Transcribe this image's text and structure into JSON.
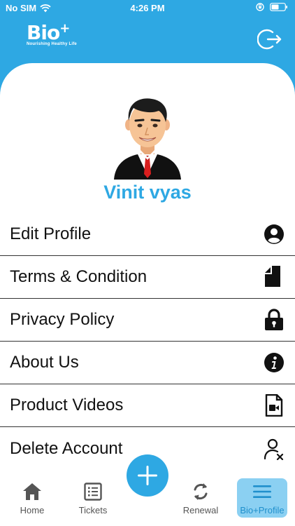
{
  "status_bar": {
    "carrier": "No SIM",
    "time": "4:26 PM"
  },
  "header": {
    "logo_text": "Bio",
    "logo_plus": "+",
    "logo_tagline": "Nourishing Healthy Life",
    "logout_icon": "logout-icon"
  },
  "profile": {
    "name": "Vinit vyas",
    "avatar_icon": "user-avatar"
  },
  "menu": {
    "items": [
      {
        "label": "Edit Profile",
        "icon": "user-circle-icon"
      },
      {
        "label": "Terms & Condition",
        "icon": "document-icon"
      },
      {
        "label": "Privacy Policy",
        "icon": "lock-icon"
      },
      {
        "label": "About Us",
        "icon": "info-icon"
      },
      {
        "label": "Product Videos",
        "icon": "video-file-icon"
      },
      {
        "label": "Delete Account",
        "icon": "user-remove-icon"
      }
    ]
  },
  "tabbar": {
    "tabs": [
      {
        "label": "Home",
        "icon": "home-icon"
      },
      {
        "label": "Tickets",
        "icon": "list-icon"
      },
      {
        "label": "Renewal",
        "icon": "refresh-icon"
      },
      {
        "label": "Bio+Profile",
        "icon": "menu-icon"
      }
    ],
    "active_tab": "Bio+Profile",
    "fab_icon": "plus-icon"
  },
  "colors": {
    "brand_blue": "#2ea8e3",
    "active_tab_bg": "#8bd0f2"
  }
}
